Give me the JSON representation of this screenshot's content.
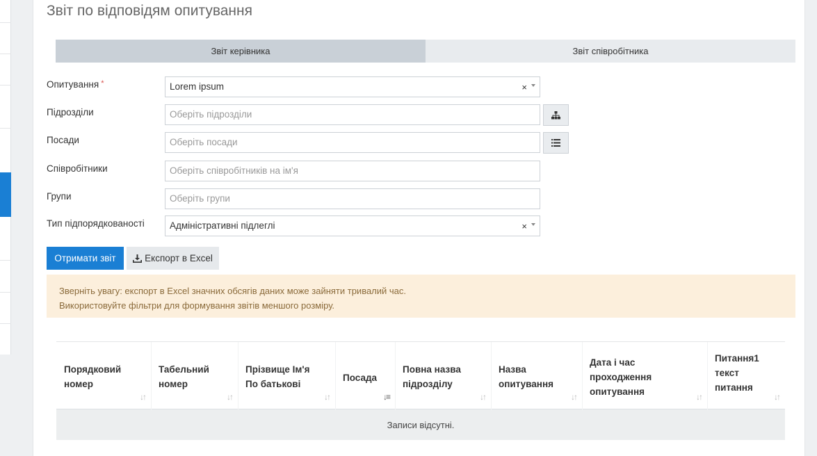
{
  "page": {
    "title": "Звіт по відповідям опитування"
  },
  "tabs": [
    {
      "label": "Звіт керівника",
      "active": true
    },
    {
      "label": "Звіт співробітника",
      "active": false
    }
  ],
  "form": {
    "survey": {
      "label": "Опитування",
      "required_mark": "*",
      "value": "Lorem ipsum",
      "clear": "×"
    },
    "departments": {
      "label": "Підрозділи",
      "placeholder": "Оберіть підрозділи",
      "button_icon": "sitemap-icon"
    },
    "positions": {
      "label": "Посади",
      "placeholder": "Оберіть посади",
      "button_icon": "list-icon"
    },
    "employees": {
      "label": "Співробітники",
      "placeholder": "Оберіть співробітників на ім'я"
    },
    "groups": {
      "label": "Групи",
      "placeholder": "Оберіть групи"
    },
    "subordination": {
      "label": "Тип підпорядкованості",
      "value": "Адміністративні підлеглі",
      "clear": "×"
    }
  },
  "actions": {
    "get_report": "Отримати звіт",
    "export_excel": "Експорт в Excel",
    "export_icon": "download-icon"
  },
  "alert": {
    "line1": "Зверніть увагу: експорт в Excel значних обсягів даних може зайняти тривалий час.",
    "line2": "Використовуйте фільтри для формування звітів меншого розміру."
  },
  "table": {
    "columns": [
      {
        "l1": "Порядковий",
        "l2": "номер",
        "l3": "",
        "sort": "both"
      },
      {
        "l1": "Табельний",
        "l2": "номер",
        "l3": "",
        "sort": "both"
      },
      {
        "l1": "Прізвище Ім'я",
        "l2": "По батькові",
        "l3": "",
        "sort": "both"
      },
      {
        "l1": "Посада",
        "l2": "",
        "l3": "",
        "sort": "desc"
      },
      {
        "l1": "Повна назва",
        "l2": "підрозділу",
        "l3": "",
        "sort": "both"
      },
      {
        "l1": "Назва",
        "l2": "опитування",
        "l3": "",
        "sort": "both"
      },
      {
        "l1": "Дата і час",
        "l2": "проходження",
        "l3": "опитування",
        "sort": "both"
      },
      {
        "l1": "Питання1",
        "l2": "текст",
        "l3": "питання",
        "sort": "both"
      }
    ],
    "empty_text": "Записи відсутні."
  },
  "colors": {
    "primary": "#1a7fd4",
    "tab_active": "#c9d0d7",
    "tab_inactive": "#e8ebee",
    "alert_bg": "#fcefdc",
    "alert_text": "#8a6a3a"
  }
}
